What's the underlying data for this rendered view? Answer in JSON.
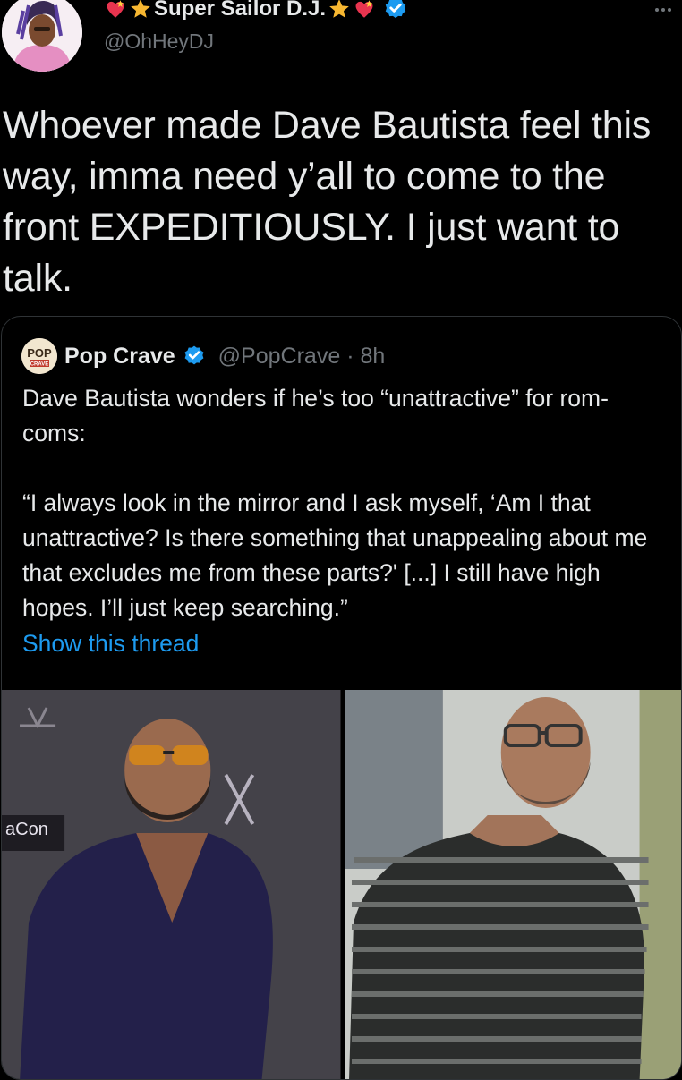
{
  "author": {
    "display_name": "Super Sailor D.J.",
    "handle": "@OhHeyDJ",
    "verified": true,
    "name_emojis": [
      "heart-icon",
      "star-icon"
    ]
  },
  "tweet": {
    "text": "Whoever made Dave Bautista feel this way, imma need y’all to come to the front EXPEDITIOUSLY. I just want to talk."
  },
  "quoted_tweet": {
    "display_name": "Pop Crave",
    "handle": "@PopCrave",
    "separator": "·",
    "time": "8h",
    "verified": true,
    "logo_text": "POP",
    "logo_subtext": "CRAVE",
    "paragraph_1": "Dave Bautista wonders if he’s too “unattractive” for rom-coms:",
    "paragraph_2": "“I always look in the mirror and I ask myself, ‘Am I that unattractive? Is there something that unappealing about me that excludes me from these parts?' [...] I still have high hopes. I’ll just keep searching.”",
    "show_thread_label": "Show this thread",
    "photos": [
      "photo-dave-bautista-purple-shirt",
      "photo-dave-bautista-striped-sweater"
    ]
  },
  "colors": {
    "background": "#000000",
    "text": "#e7e9ea",
    "muted": "#71767b",
    "link": "#1d9bf0",
    "border": "#2f3336",
    "verified": "#1d9bf0"
  }
}
